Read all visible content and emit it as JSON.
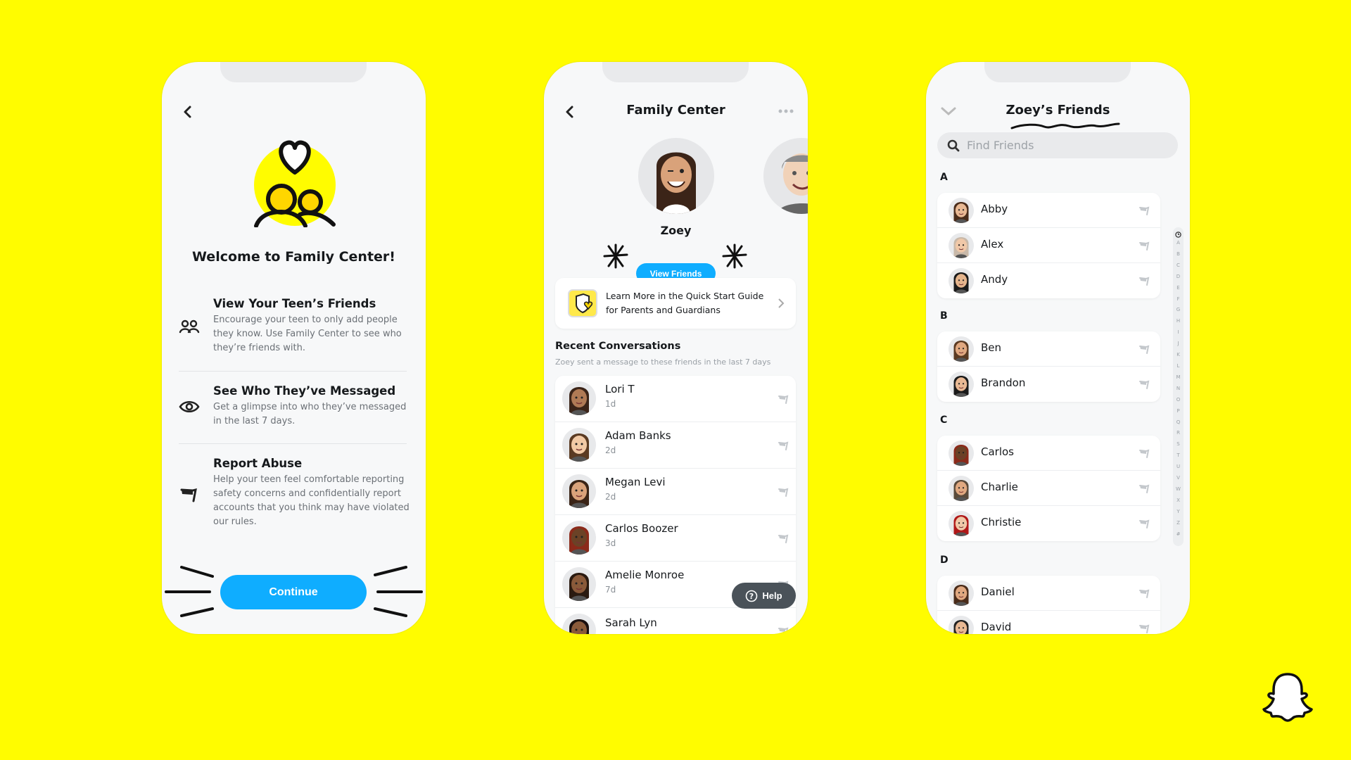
{
  "colors": {
    "background": "#FFFC00",
    "accent": "#0FADFF",
    "help": "#4A5259"
  },
  "welcome": {
    "back_icon": "chevron-left-icon",
    "title": "Welcome to Family Center!",
    "features": [
      {
        "icon": "friends-icon",
        "title": "View Your Teen’s Friends",
        "body": "Encourage your teen to only add people they know. Use Family Center to see who they’re friends with."
      },
      {
        "icon": "eye-icon",
        "title": "See Who They’ve Messaged",
        "body": "Get a glimpse into who they’ve messaged in the last 7 days."
      },
      {
        "icon": "flag-icon",
        "title": "Report Abuse",
        "body": "Help your teen feel comfortable reporting safety concerns and confidentially report accounts that you think may have violated our rules."
      }
    ],
    "continue_label": "Continue"
  },
  "family_center": {
    "title": "Family Center",
    "teen_name": "Zoey",
    "view_friends_label": "View Friends",
    "guide_text": "Learn More in the Quick Start Guide for Parents and Guardians",
    "recent_title": "Recent Conversations",
    "recent_subtitle": "Zoey sent a message to these friends in the last 7 days",
    "conversations": [
      {
        "name": "Lori T",
        "time": "1d",
        "skin": "#b07a55",
        "hair": "#3b2418"
      },
      {
        "name": "Adam Banks",
        "time": "2d",
        "skin": "#f1c9a5",
        "hair": "#5a3a22"
      },
      {
        "name": "Megan Levi",
        "time": "2d",
        "skin": "#d9a27a",
        "hair": "#3a2416"
      },
      {
        "name": "Carlos Boozer",
        "time": "3d",
        "skin": "#6b4226",
        "hair": "#8b2a1a"
      },
      {
        "name": "Amelie Monroe",
        "time": "7d",
        "skin": "#8a5a3a",
        "hair": "#2a1a10"
      },
      {
        "name": "Sarah Lyn",
        "time": "",
        "skin": "#8a5a3a",
        "hair": "#1a1010"
      }
    ],
    "help_label": "Help"
  },
  "friends": {
    "title": "Zoey’s Friends",
    "search_placeholder": "Find Friends",
    "sections": [
      {
        "letter": "A",
        "items": [
          {
            "name": "Abby",
            "skin": "#e8b893",
            "hair": "#4a2c1a"
          },
          {
            "name": "Alex",
            "skin": "#f0c8a8",
            "hair": "#c9b9a9"
          },
          {
            "name": "Andy",
            "skin": "#e4b48c",
            "hair": "#1a1a1a"
          }
        ]
      },
      {
        "letter": "B",
        "items": [
          {
            "name": "Ben",
            "skin": "#e0a880",
            "hair": "#5a3a22"
          },
          {
            "name": "Brandon",
            "skin": "#e8b893",
            "hair": "#1a1a1a"
          }
        ]
      },
      {
        "letter": "C",
        "items": [
          {
            "name": "Carlos",
            "skin": "#6b4226",
            "hair": "#8b2a1a"
          },
          {
            "name": "Charlie",
            "skin": "#e0a880",
            "hair": "#5a4a3a"
          },
          {
            "name": "Christie",
            "skin": "#f0c8a8",
            "hair": "#b01818"
          }
        ]
      },
      {
        "letter": "D",
        "items": [
          {
            "name": "Daniel",
            "skin": "#e0a880",
            "hair": "#4a2c1a"
          },
          {
            "name": "David",
            "skin": "#e8b893",
            "hair": "#222"
          }
        ]
      }
    ],
    "index": [
      "A",
      "B",
      "C",
      "D",
      "E",
      "F",
      "G",
      "H",
      "I",
      "J",
      "K",
      "L",
      "M",
      "N",
      "O",
      "P",
      "Q",
      "R",
      "S",
      "T",
      "U",
      "V",
      "W",
      "X",
      "Y",
      "Z",
      "#"
    ]
  }
}
